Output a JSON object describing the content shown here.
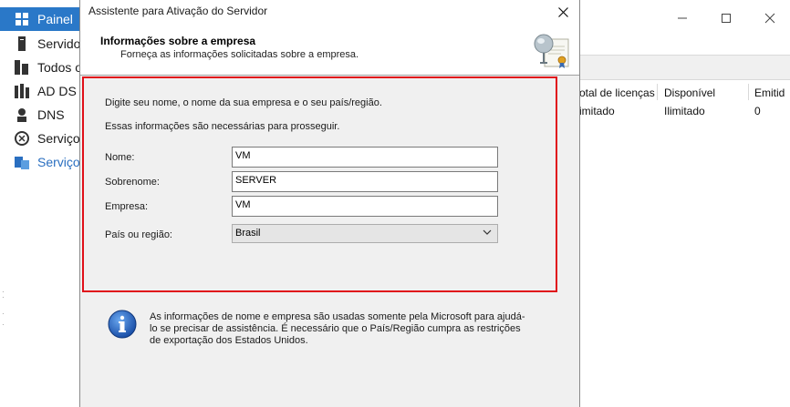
{
  "sidebar": {
    "items": [
      {
        "label": "Painel",
        "icon": "dashboard-icon"
      },
      {
        "label": "Servido",
        "icon": "server-icon"
      },
      {
        "label": "Todos o",
        "icon": "all-servers-icon"
      },
      {
        "label": "AD DS",
        "icon": "ad-ds-icon"
      },
      {
        "label": "DNS",
        "icon": "dns-icon"
      },
      {
        "label": "Serviços",
        "icon": "services-icon"
      },
      {
        "label": "Serviços",
        "icon": "file-services-icon"
      }
    ]
  },
  "background_table": {
    "headers": [
      "otal de licenças",
      "Disponível",
      "Emitid"
    ],
    "row": [
      "imitado",
      "Ilimitado",
      "0"
    ]
  },
  "dialog": {
    "title": "Assistente para Ativação do Servidor",
    "header_title": "Informações sobre a empresa",
    "header_subtitle": "Forneça as informações solicitadas sobre a empresa.",
    "intro_line1": "Digite seu nome, o nome da sua empresa e o seu país/região.",
    "intro_line2": "Essas informações são necessárias para prosseguir.",
    "fields": {
      "name_label": "Nome:",
      "name_value": "VM",
      "surname_label": "Sobrenome:",
      "surname_value": "SERVER",
      "company_label": "Empresa:",
      "company_value": "VM",
      "country_label": "País ou região:",
      "country_value": "Brasil"
    },
    "info_text": "As informações de nome e empresa são usadas somente pela Microsoft para ajudá-lo se precisar de assistência. É necessário que o País/Região cumpra as restrições de exportação dos Estados Unidos."
  },
  "colors": {
    "accent": "#2a78c8",
    "highlight_border": "#e0101a"
  }
}
